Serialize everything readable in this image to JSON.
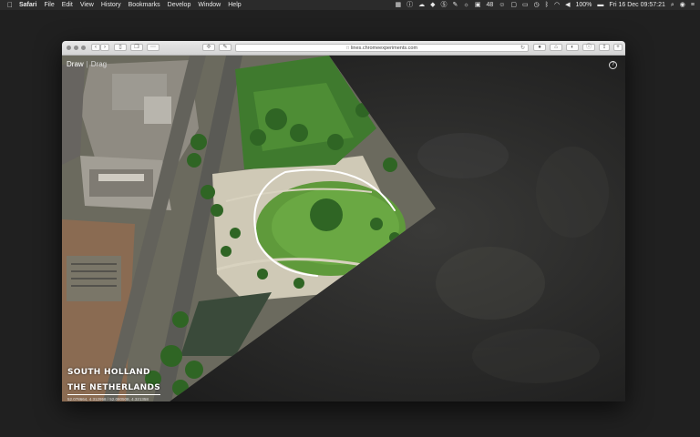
{
  "menubar": {
    "items": [
      "Safari",
      "File",
      "Edit",
      "View",
      "History",
      "Bookmarks",
      "Develop",
      "Window",
      "Help"
    ],
    "status_number": "48",
    "battery": "100%",
    "datetime": "Fri 16 Dec  09:57:21"
  },
  "browser": {
    "url": "lines.chromeexperiments.com"
  },
  "app": {
    "nav_draw": "Draw",
    "nav_separator": "|",
    "nav_drag": "Drag",
    "help_label": "?",
    "location_line1": "SOUTH HOLLAND",
    "location_line2": "THE NETHERLANDS",
    "coordinates": "52.078664, 4.312958 / 52.080508, 4.321358"
  },
  "colors": {
    "menubar_bg": "#2b2b2b",
    "desktop_bg": "#202020",
    "toolbar_bg": "#e0e0e0",
    "drawn_line": "#ffffff"
  }
}
